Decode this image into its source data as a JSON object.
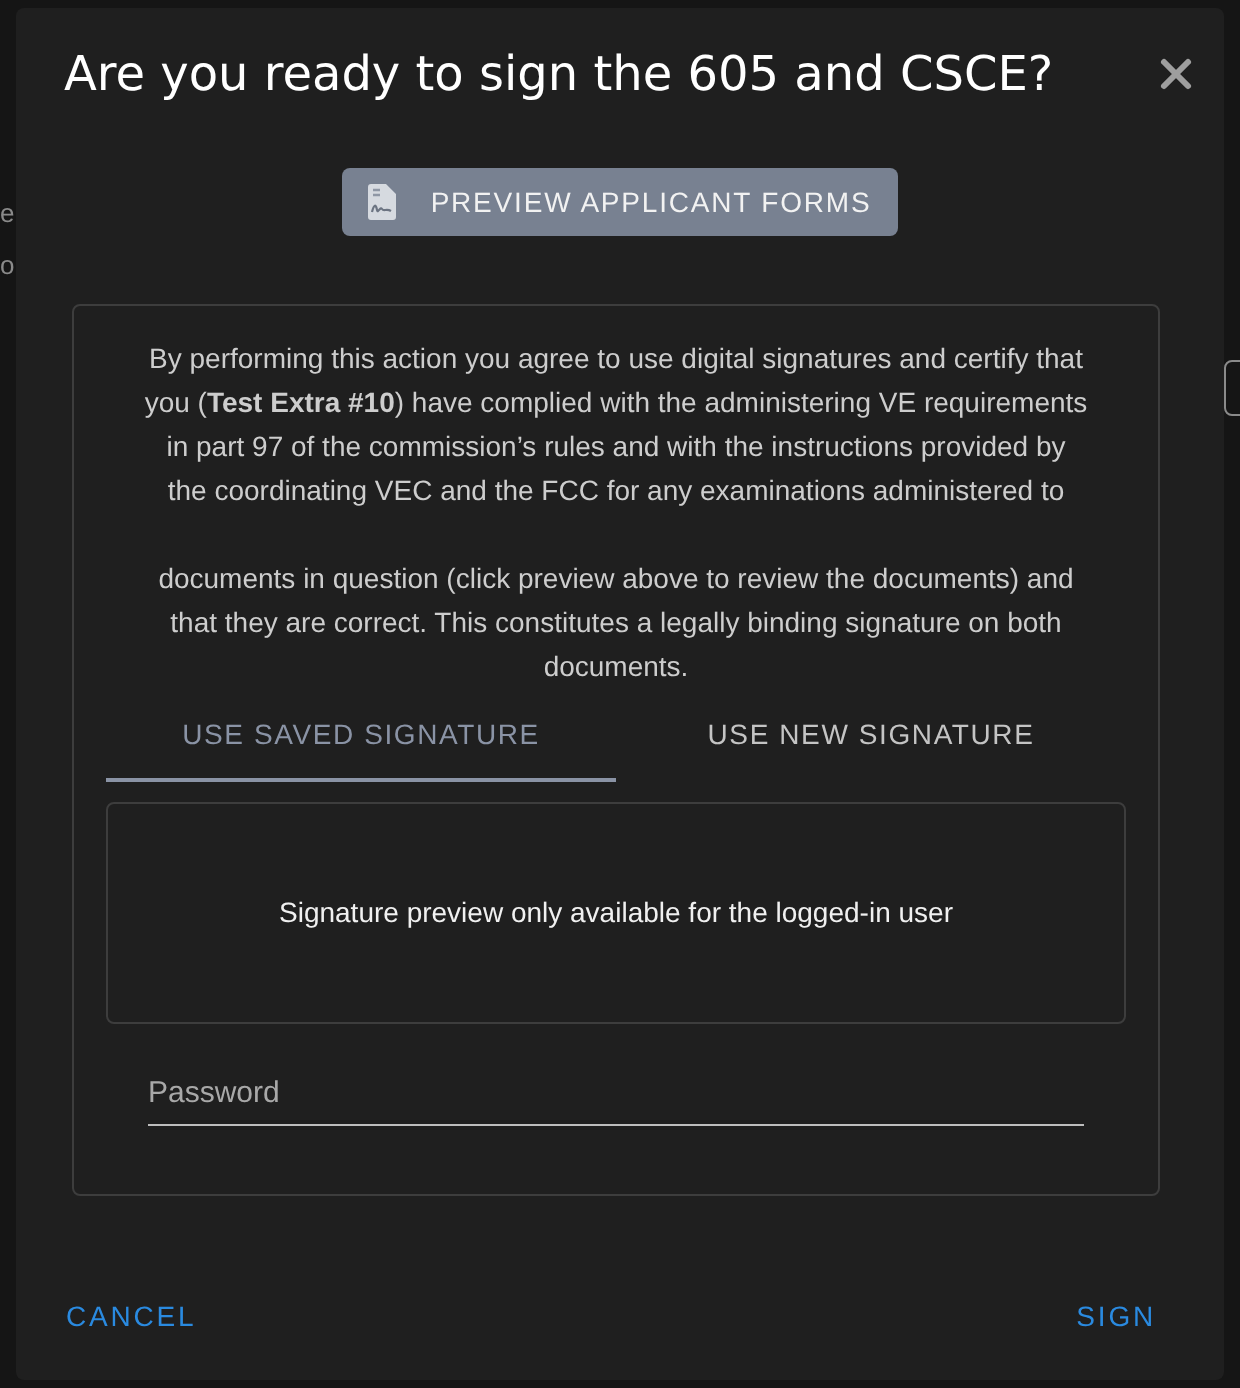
{
  "background": {
    "text_fragments": [
      "e",
      "o"
    ]
  },
  "dialog": {
    "title": "Are you ready to sign the 605 and CSCE?",
    "preview_button": "PREVIEW APPLICANT FORMS",
    "agreement": [
      "By performing this action you agree to use digital signatures and certify that you (**Test Extra #10**) have complied with the administering VE requirements in part 97 of the commission’s rules and with the instructions provided by the coordinating VEC and the FCC for any examinations administered to",
      "documents in question (click preview above to review the documents) and that they are correct. This constitutes a legally binding signature on both documents."
    ],
    "tabs": [
      {
        "label": "USE SAVED SIGNATURE",
        "selected": true
      },
      {
        "label": "USE NEW SIGNATURE",
        "selected": false
      }
    ],
    "signature_preview": "Signature preview only available for the logged-in user",
    "password": {
      "placeholder": "Password"
    },
    "actions": [
      "CANCEL",
      "SIGN"
    ]
  }
}
